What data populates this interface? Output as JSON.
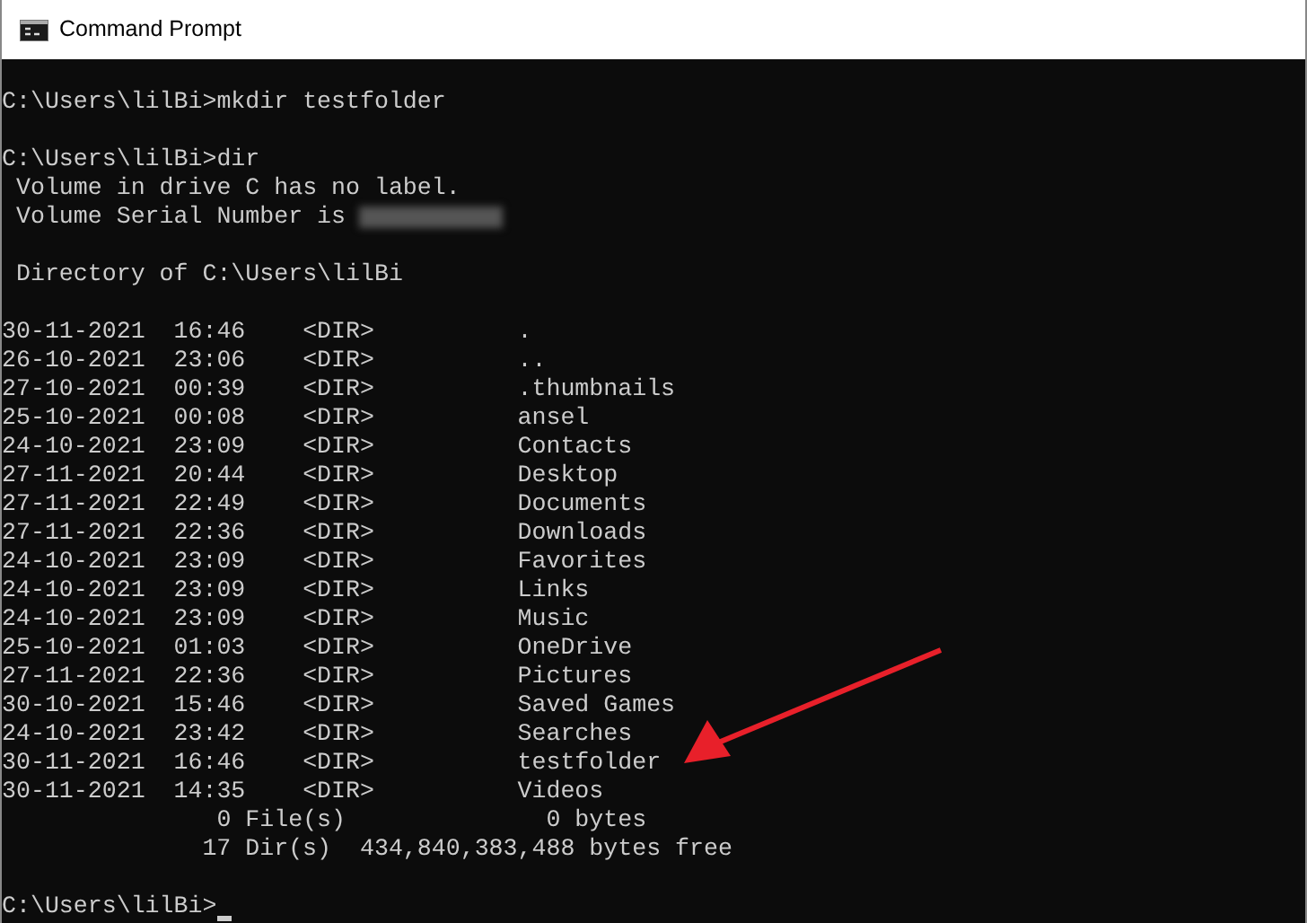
{
  "window": {
    "title": "Command Prompt"
  },
  "console": {
    "pre_lines": [
      {
        "text": "C:\\Users\\lilBi>mkdir testfolder",
        "gap_before": true
      },
      {
        "text": "C:\\Users\\lilBi>dir",
        "gap_before": true
      },
      {
        "text": " Volume in drive C has no label.",
        "gap_before": false
      },
      {
        "text": " Volume Serial Number is",
        "gap_before": false,
        "redacted": true
      },
      {
        "text": " Directory of C:\\Users\\lilBi",
        "gap_before": true
      }
    ],
    "entries": [
      {
        "date": "30-11-2021",
        "time": "16:46",
        "type": "<DIR>",
        "name": "."
      },
      {
        "date": "26-10-2021",
        "time": "23:06",
        "type": "<DIR>",
        "name": ".."
      },
      {
        "date": "27-10-2021",
        "time": "00:39",
        "type": "<DIR>",
        "name": ".thumbnails"
      },
      {
        "date": "25-10-2021",
        "time": "00:08",
        "type": "<DIR>",
        "name": "ansel"
      },
      {
        "date": "24-10-2021",
        "time": "23:09",
        "type": "<DIR>",
        "name": "Contacts"
      },
      {
        "date": "27-11-2021",
        "time": "20:44",
        "type": "<DIR>",
        "name": "Desktop"
      },
      {
        "date": "27-11-2021",
        "time": "22:49",
        "type": "<DIR>",
        "name": "Documents"
      },
      {
        "date": "27-11-2021",
        "time": "22:36",
        "type": "<DIR>",
        "name": "Downloads"
      },
      {
        "date": "24-10-2021",
        "time": "23:09",
        "type": "<DIR>",
        "name": "Favorites"
      },
      {
        "date": "24-10-2021",
        "time": "23:09",
        "type": "<DIR>",
        "name": "Links"
      },
      {
        "date": "24-10-2021",
        "time": "23:09",
        "type": "<DIR>",
        "name": "Music"
      },
      {
        "date": "25-10-2021",
        "time": "01:03",
        "type": "<DIR>",
        "name": "OneDrive"
      },
      {
        "date": "27-11-2021",
        "time": "22:36",
        "type": "<DIR>",
        "name": "Pictures"
      },
      {
        "date": "30-10-2021",
        "time": "15:46",
        "type": "<DIR>",
        "name": "Saved Games"
      },
      {
        "date": "24-10-2021",
        "time": "23:42",
        "type": "<DIR>",
        "name": "Searches"
      },
      {
        "date": "30-11-2021",
        "time": "16:46",
        "type": "<DIR>",
        "name": "testfolder",
        "highlighted": true
      },
      {
        "date": "30-11-2021",
        "time": "14:35",
        "type": "<DIR>",
        "name": "Videos"
      }
    ],
    "summary": [
      {
        "count": "0 File(s)",
        "size": "0 bytes"
      },
      {
        "count": "17 Dir(s)",
        "size": "434,840,383,488 bytes free"
      }
    ],
    "prompt": "C:\\Users\\lilBi>",
    "cursor": true
  }
}
